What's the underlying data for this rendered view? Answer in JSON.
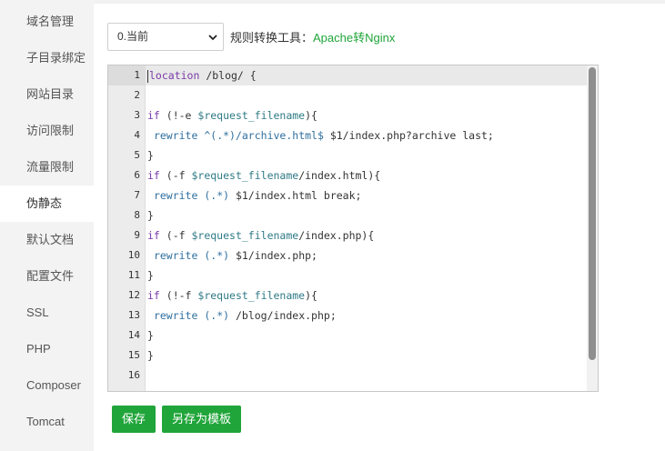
{
  "sidebar": {
    "items": [
      {
        "label": "域名管理"
      },
      {
        "label": "子目录绑定"
      },
      {
        "label": "网站目录"
      },
      {
        "label": "访问限制"
      },
      {
        "label": "流量限制"
      },
      {
        "label": "伪静态",
        "active": true
      },
      {
        "label": "默认文档"
      },
      {
        "label": "配置文件"
      },
      {
        "label": "SSL"
      },
      {
        "label": "PHP"
      },
      {
        "label": "Composer"
      },
      {
        "label": "Tomcat"
      }
    ]
  },
  "toolbar": {
    "template_select_value": "0.当前",
    "rule_tool_label": "规则转换工具：",
    "rule_tool_link": "Apache转Nginx"
  },
  "editor": {
    "active_line": 1,
    "line_numbers": [
      "1",
      "2",
      "3",
      "4",
      "5",
      "6",
      "7",
      "8",
      "9",
      "10",
      "11",
      "12",
      "13",
      "14",
      "15",
      "16"
    ],
    "lines": [
      "location /blog/ {",
      "",
      "if (!-e $request_filename){",
      " rewrite ^(.*)/archive.html$ $1/index.php?archive last;",
      "}",
      "if (-f $request_filename/index.html){",
      " rewrite (.*) $1/index.html break;",
      "}",
      "if (-f $request_filename/index.php){",
      " rewrite (.*) $1/index.php;",
      "}",
      "if (!-f $request_filename){",
      " rewrite (.*) /blog/index.php;",
      "}",
      "}",
      ""
    ]
  },
  "actions": {
    "save_label": "保存",
    "save_as_template_label": "另存为模板"
  },
  "colors": {
    "accent": "#20a53a",
    "sidebar_bg": "#f3f3f3",
    "gutter_bg": "#ececec"
  }
}
